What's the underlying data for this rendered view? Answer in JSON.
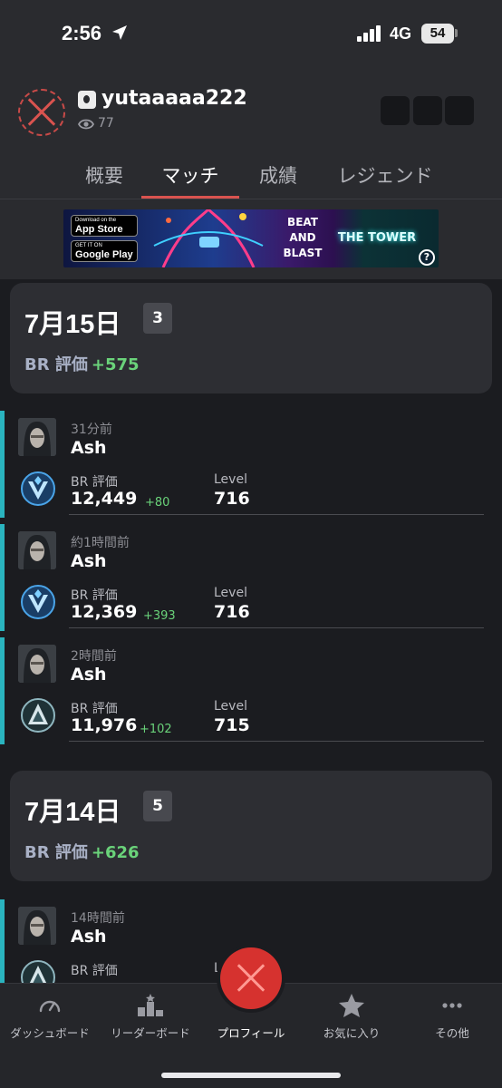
{
  "status_bar": {
    "time": "2:56",
    "network": "4G",
    "battery": "54",
    "icons": [
      "location-arrow-icon",
      "signal-bars-icon",
      "battery-icon"
    ]
  },
  "profile": {
    "username": "yutaaaaa222",
    "views": "77",
    "icons": [
      "avatar-placeholder-icon",
      "platform-icon",
      "eye-icon"
    ]
  },
  "tabs": [
    {
      "label": "概要",
      "active": false
    },
    {
      "label": "マッチ",
      "active": true
    },
    {
      "label": "成績",
      "active": false
    },
    {
      "label": "レジェンド",
      "active": false
    }
  ],
  "ad": {
    "app_store_small": "Download on the",
    "app_store": "App Store",
    "google_play_small": "GET IT ON",
    "google_play": "Google Play",
    "beat": "BEAT",
    "and": "AND",
    "blast": "BLAST",
    "tower": "THE TOWER",
    "help": "?"
  },
  "days": [
    {
      "date": "7月15日",
      "count": "3",
      "br_label": "BR 評価",
      "br_gain": "+575",
      "matches": [
        {
          "time": "31分前",
          "legend": "Ash",
          "br_label": "BR 評価",
          "br_value": "12,449",
          "br_delta": "+80",
          "level_label": "Level",
          "level": "716",
          "rank_icon": "diamond-iv-rank-icon"
        },
        {
          "time": "約1時間前",
          "legend": "Ash",
          "br_label": "BR 評価",
          "br_value": "12,369",
          "br_delta": "+393",
          "level_label": "Level",
          "level": "716",
          "rank_icon": "diamond-iv-rank-icon"
        },
        {
          "time": "2時間前",
          "legend": "Ash",
          "br_label": "BR 評価",
          "br_value": "11,976",
          "br_delta": "+102",
          "level_label": "Level",
          "level": "715",
          "rank_icon": "platinum-i-rank-icon"
        }
      ]
    },
    {
      "date": "7月14日",
      "count": "5",
      "br_label": "BR 評価",
      "br_gain": "+626",
      "matches": [
        {
          "time": "14時間前",
          "legend": "Ash",
          "br_label": "BR 評価",
          "level_label": "Level",
          "rank_icon": "platinum-rank-icon"
        }
      ]
    }
  ],
  "bottom_nav": [
    {
      "label": "ダッシュボード",
      "icon": "gauge-icon"
    },
    {
      "label": "リーダーボード",
      "icon": "leaderboard-icon"
    },
    {
      "label": "プロフィール",
      "icon": "profile-fab-icon"
    },
    {
      "label": "お気に入り",
      "icon": "star-icon"
    },
    {
      "label": "その他",
      "icon": "more-icon"
    }
  ],
  "colors": {
    "background": "#1b1c20",
    "header": "#2a2b2f",
    "card": "#2d2e33",
    "accent_red": "#d9534f",
    "gain_green": "#6ad37a",
    "match_bar_teal": "#2ab4bf"
  }
}
